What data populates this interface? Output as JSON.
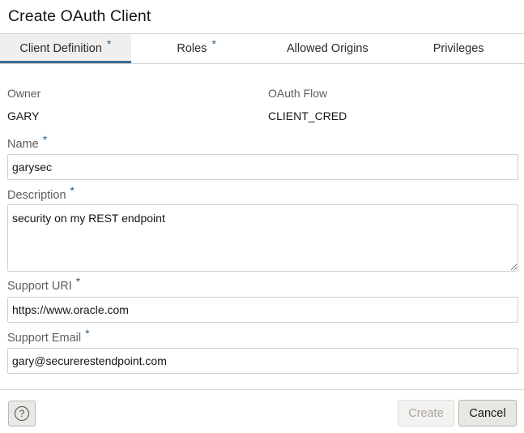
{
  "dialog": {
    "title": "Create OAuth Client"
  },
  "tabs": [
    {
      "label": "Client Definition",
      "required": "*"
    },
    {
      "label": "Roles",
      "required": "*"
    },
    {
      "label": "Allowed Origins",
      "required": ""
    },
    {
      "label": "Privileges",
      "required": ""
    }
  ],
  "active_tab": "Client Definition",
  "readonly": {
    "owner_label": "Owner",
    "owner_value": "GARY",
    "flow_label": "OAuth Flow",
    "flow_value": "CLIENT_CRED"
  },
  "form": {
    "required_mark": "*",
    "name": {
      "label": "Name",
      "value": "garysec"
    },
    "description": {
      "label": "Description",
      "value": "security on my REST endpoint"
    },
    "support_uri": {
      "label": "Support URI",
      "value": "https://www.oracle.com"
    },
    "support_email": {
      "label": "Support Email",
      "value": "gary@securerestendpoint.com"
    }
  },
  "footer": {
    "help_icon_glyph": "?",
    "create_label": "Create",
    "create_disabled": true,
    "cancel_label": "Cancel"
  }
}
